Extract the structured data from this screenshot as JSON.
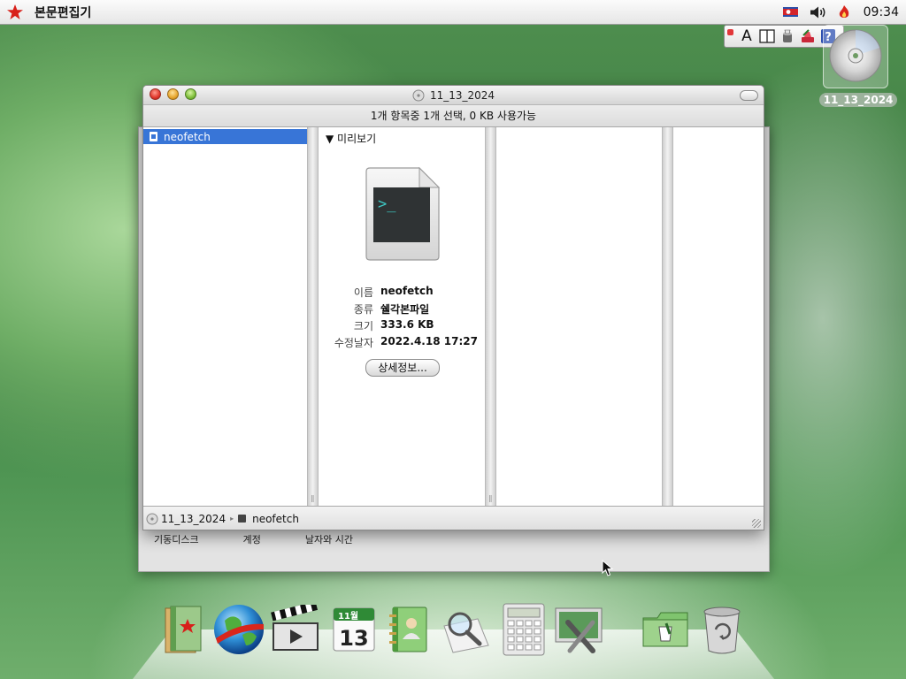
{
  "menubar": {
    "app_name": "본문편집기",
    "clock": "09:34"
  },
  "desktop": {
    "disc_label": "11_13_2024"
  },
  "back_window": {
    "labels": [
      "기동디스크",
      "계정",
      "날자와 시간"
    ]
  },
  "finder": {
    "title": "11_13_2024",
    "status": "1개 항목중 1개 선택, 0 KB 사용가능",
    "column1_selected": "neofetch",
    "preview": {
      "header": "▼ 미리보기",
      "rows": [
        {
          "label": "이름",
          "value": "neofetch"
        },
        {
          "label": "종류",
          "value": "쉘각본파일"
        },
        {
          "label": "크기",
          "value": "333.6 KB"
        },
        {
          "label": "수정날자",
          "value": "2022.4.18 17:27"
        }
      ],
      "more_button": "상세정보...",
      "terminal_prompt": ">_"
    },
    "pathbar": {
      "volume": "11_13_2024",
      "file": "neofetch"
    }
  },
  "palette": {
    "text_tool": "A"
  },
  "dock": {
    "calendar_month": "11월",
    "calendar_day": "13"
  },
  "colors": {
    "selection": "#3875d7",
    "close": "#e0362b",
    "minimize": "#e7a52c",
    "zoom": "#7fbf3a"
  }
}
